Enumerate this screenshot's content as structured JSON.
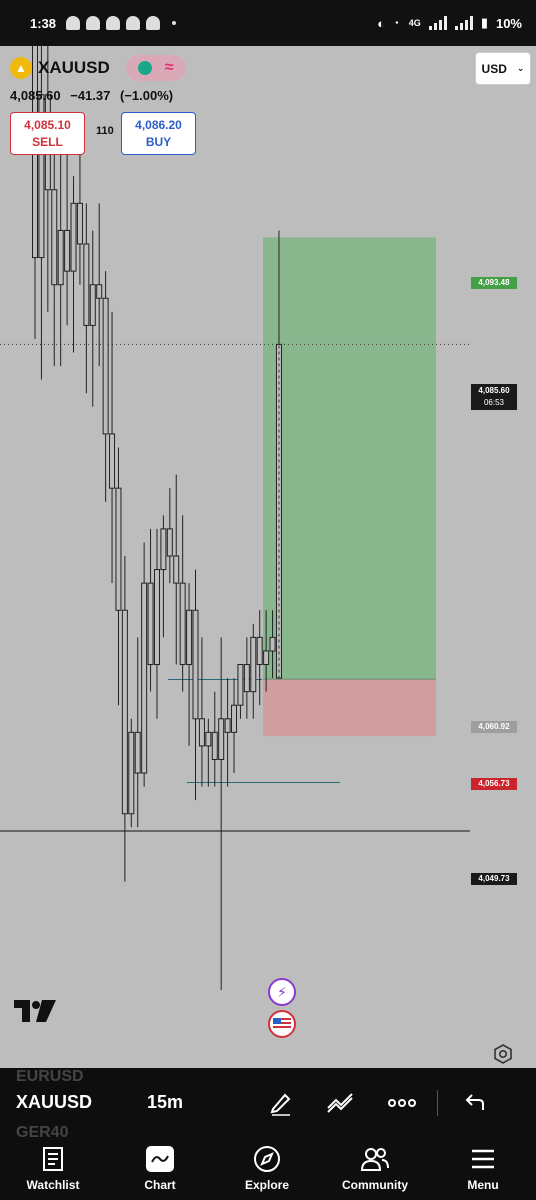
{
  "status_bar": {
    "time": "1:38",
    "network": "4G",
    "battery": "10%"
  },
  "symbol": {
    "name": "XAUUSD",
    "last": "4,085.60",
    "change": "−41.37",
    "change_pct": "(−1.00%)"
  },
  "trade": {
    "sell_price": "4,085.10",
    "sell_label": "SELL",
    "spread": "110",
    "buy_price": "4,086.20",
    "buy_label": "BUY"
  },
  "currency": {
    "value": "USD"
  },
  "price_labels": {
    "target": "4,093.48",
    "current": "4,085.60",
    "countdown": "06:53",
    "entry": "4,060.92",
    "stop": "4,056.73",
    "horizontal": "4,049.73"
  },
  "colors": {
    "profit_zone": "#7fb685",
    "loss_zone": "#d29a9a",
    "chart_bg": "#bdbdbd",
    "sell": "#d0323c",
    "buy": "#2c5ec9"
  },
  "bottom_toolbar": {
    "prev_symbol": "EURUSD",
    "symbol": "XAUUSD",
    "next_symbol": "GER40",
    "interval": "15m"
  },
  "nav": {
    "items": [
      {
        "label": "Watchlist",
        "icon": "watchlist-icon"
      },
      {
        "label": "Chart",
        "icon": "chart-icon"
      },
      {
        "label": "Explore",
        "icon": "compass-icon"
      },
      {
        "label": "Community",
        "icon": "community-icon"
      },
      {
        "label": "Menu",
        "icon": "menu-icon"
      }
    ]
  },
  "chart_data": {
    "type": "candlestick",
    "timeframe": "15m",
    "position": {
      "entry": 4060.92,
      "target": 4093.48,
      "stop": 4056.73
    },
    "current_price": 4085.6,
    "horizontal_lines": [
      4049.73
    ],
    "candles": [
      [
        4120,
        4124,
        4086,
        4092
      ],
      [
        4092,
        4120,
        4083,
        4104
      ],
      [
        4104,
        4112,
        4088,
        4097
      ],
      [
        4097,
        4101,
        4084,
        4090
      ],
      [
        4090,
        4100,
        4084,
        4094
      ],
      [
        4094,
        4100,
        4087,
        4091
      ],
      [
        4091,
        4098,
        4085,
        4096
      ],
      [
        4096,
        4101,
        4090,
        4093
      ],
      [
        4093,
        4096,
        4082,
        4087
      ],
      [
        4087,
        4094,
        4081,
        4090
      ],
      [
        4090,
        4096,
        4084,
        4089
      ],
      [
        4089,
        4091,
        4074,
        4079
      ],
      [
        4079,
        4088,
        4068,
        4075
      ],
      [
        4075,
        4078,
        4059,
        4066
      ],
      [
        4066,
        4070,
        4046,
        4051
      ],
      [
        4051,
        4058,
        4050,
        4057
      ],
      [
        4057,
        4064,
        4050,
        4054
      ],
      [
        4054,
        4071,
        4053,
        4068
      ],
      [
        4068,
        4072,
        4060,
        4062
      ],
      [
        4062,
        4072,
        4058,
        4069
      ],
      [
        4069,
        4073,
        4064,
        4072
      ],
      [
        4072,
        4075,
        4068,
        4070
      ],
      [
        4070,
        4076,
        4062,
        4068
      ],
      [
        4068,
        4073,
        4060,
        4062
      ],
      [
        4062,
        4068,
        4056,
        4066
      ],
      [
        4066,
        4069,
        4052,
        4058
      ],
      [
        4058,
        4064,
        4053,
        4056
      ],
      [
        4056,
        4058,
        4053,
        4057
      ],
      [
        4057,
        4060,
        4053,
        4055
      ],
      [
        4055,
        4064,
        4038,
        4058
      ],
      [
        4058,
        4061,
        4053,
        4057
      ],
      [
        4057,
        4061,
        4054,
        4059
      ],
      [
        4059,
        4062,
        4058,
        4062
      ],
      [
        4062,
        4064,
        4058,
        4060
      ],
      [
        4060,
        4065,
        4058,
        4064
      ],
      [
        4064,
        4066,
        4059,
        4062
      ],
      [
        4062,
        4066,
        4060,
        4063
      ],
      [
        4063,
        4066,
        4061,
        4064
      ],
      [
        4061,
        4094,
        4061,
        4085.6
      ]
    ]
  }
}
